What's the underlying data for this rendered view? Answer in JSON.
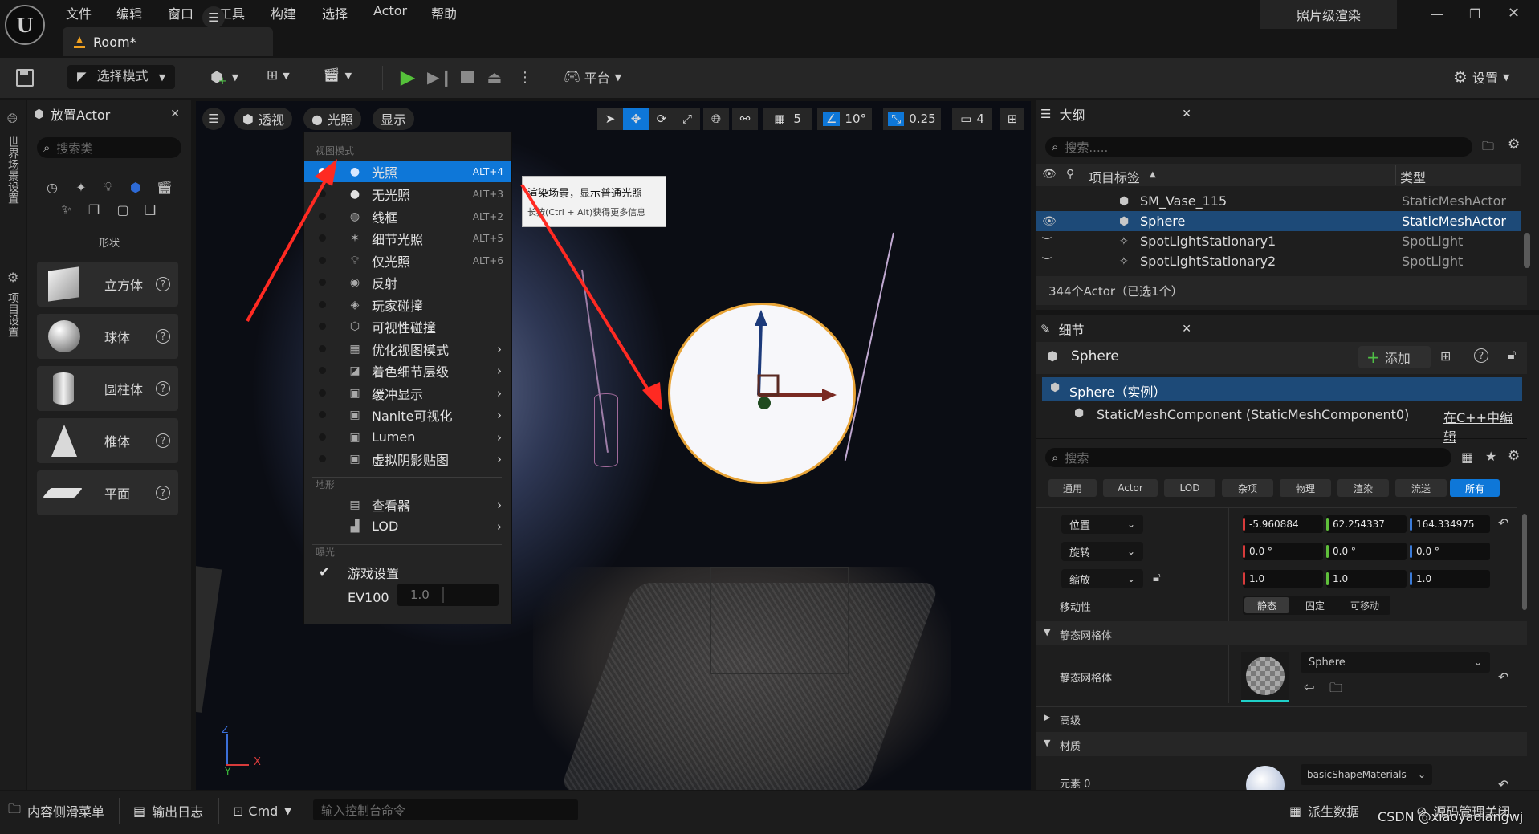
{
  "app": {
    "logo": "unreal-engine-logo",
    "document_tab": "Room*",
    "quality_badge": "照片级渲染"
  },
  "menu": [
    "文件",
    "编辑",
    "窗口",
    "工具",
    "构建",
    "选择",
    "Actor",
    "帮助"
  ],
  "toolbar": {
    "mode_label": "选择模式",
    "platform_label": "平台",
    "settings_label": "设置"
  },
  "left_tabs": [
    "世界场景设置",
    "项目设置"
  ],
  "place_actor": {
    "title": "放置Actor",
    "search_placeholder": "搜索类",
    "category_label": "形状",
    "shapes": [
      {
        "label": "立方体",
        "icon": "cube-icon"
      },
      {
        "label": "球体",
        "icon": "sphere-icon"
      },
      {
        "label": "圆柱体",
        "icon": "cylinder-icon"
      },
      {
        "label": "椎体",
        "icon": "cone-icon"
      },
      {
        "label": "平面",
        "icon": "plane-icon"
      }
    ]
  },
  "viewport": {
    "perspective_label": "透视",
    "lighting_label": "光照",
    "show_label": "显示",
    "grid_size": "5",
    "angle_snap": "10°",
    "scale_snap": "0.25",
    "camera_speed": "4"
  },
  "view_mode_menu": {
    "section_view_mode": "视图模式",
    "items": [
      {
        "label": "光照",
        "shortcut": "ALT+4",
        "active": true
      },
      {
        "label": "无光照",
        "shortcut": "ALT+3"
      },
      {
        "label": "线框",
        "shortcut": "ALT+2"
      },
      {
        "label": "细节光照",
        "shortcut": "ALT+5"
      },
      {
        "label": "仅光照",
        "shortcut": "ALT+6"
      },
      {
        "label": "反射",
        "shortcut": ""
      },
      {
        "label": "玩家碰撞",
        "shortcut": ""
      },
      {
        "label": "可视性碰撞",
        "shortcut": ""
      },
      {
        "label": "优化视图模式",
        "shortcut": "",
        "submenu": true
      },
      {
        "label": "着色细节层级",
        "shortcut": "",
        "submenu": true
      },
      {
        "label": "缓冲显示",
        "shortcut": "",
        "submenu": true
      },
      {
        "label": "Nanite可视化",
        "shortcut": "",
        "submenu": true
      },
      {
        "label": "Lumen",
        "shortcut": "",
        "submenu": true
      },
      {
        "label": "虚拟阴影贴图",
        "shortcut": "",
        "submenu": true
      }
    ],
    "section_terrain": "地形",
    "terrain_items": [
      {
        "label": "查看器",
        "submenu": true
      },
      {
        "label": "LOD",
        "submenu": true
      }
    ],
    "section_exposure": "曝光",
    "game_settings_label": "游戏设置",
    "ev100_label": "EV100",
    "ev100_value": "1.0",
    "tooltip_title": "渲染场景，显示普通光照",
    "tooltip_hint": "长按(Ctrl + Alt)获得更多信息"
  },
  "outliner": {
    "title": "大纲",
    "search_placeholder": "搜索.....",
    "col_label": "项目标签",
    "col_type": "类型",
    "rows": [
      {
        "name": "SM_Vase_115",
        "type": "StaticMeshActor"
      },
      {
        "name": "Sphere",
        "type": "StaticMeshActor",
        "selected": true
      },
      {
        "name": "SpotLightStationary1",
        "type": "SpotLight"
      },
      {
        "name": "SpotLightStationary2",
        "type": "SpotLight"
      }
    ],
    "footer": "344个Actor（已选1个）"
  },
  "details": {
    "title": "细节",
    "object_name": "Sphere",
    "add_label": "添加",
    "instance_label": "Sphere（实例）",
    "component_label": "StaticMeshComponent (StaticMeshComponent0)",
    "edit_cpp_link": "在C++中编辑",
    "search_placeholder": "搜索",
    "categories": [
      "通用",
      "Actor",
      "LOD",
      "杂项",
      "物理",
      "渲染",
      "流送",
      "所有"
    ],
    "active_category": "所有",
    "transform": {
      "location_label": "位置",
      "location": [
        "-5.960884",
        "62.254337",
        "164.334975"
      ],
      "rotation_label": "旋转",
      "rotation": [
        "0.0 °",
        "0.0 °",
        "0.0 °"
      ],
      "scale_label": "缩放",
      "scale": [
        "1.0",
        "1.0",
        "1.0"
      ]
    },
    "mobility_label": "移动性",
    "mobility_options": [
      "静态",
      "固定",
      "可移动"
    ],
    "static_mesh_section": "静态网格体",
    "static_mesh_label": "静态网格体",
    "static_mesh_value": "Sphere",
    "advanced_section": "高级",
    "materials_section": "材质",
    "element0_label": "元素 0",
    "material_value": "basicShapeMaterials"
  },
  "bottom_bar": {
    "content_drawer": "内容侧滑菜单",
    "output_log": "输出日志",
    "cmd_label": "Cmd",
    "console_placeholder": "输入控制台命令",
    "derived_data": "派生数据",
    "source_control": "源码管理关闭"
  },
  "watermark": "CSDN @xiaoyaolangwj",
  "colors": {
    "accent_blue": "#0e77d8",
    "selection_blue": "#1d4a78",
    "annotation_red": "#ff2a22",
    "sphere_outline": "#e8a437"
  }
}
